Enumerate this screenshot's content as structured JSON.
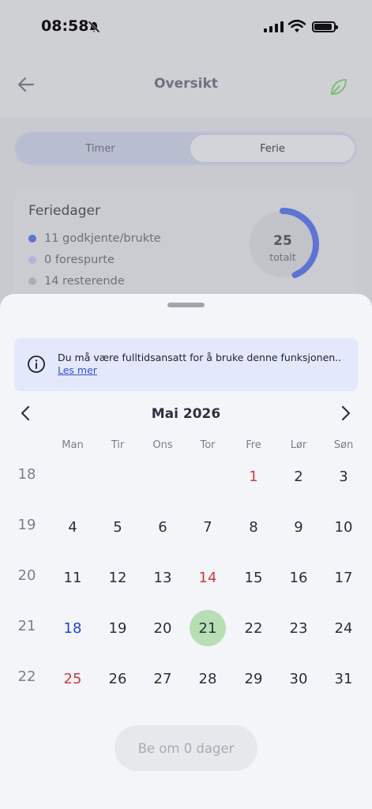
{
  "status_bar": {
    "time": "08:58"
  },
  "header": {
    "title": "Oversikt"
  },
  "segmented": {
    "timer_label": "Timer",
    "ferie_label": "Ferie",
    "selected": "Ferie"
  },
  "card": {
    "title": "Feriedager",
    "legend": [
      {
        "label": "11 godkjente/brukte",
        "color": "#5f73d3"
      },
      {
        "label": "0 forespurte",
        "color": "#aeb5d5"
      },
      {
        "label": "14 resterende",
        "color": "#adaeb3"
      }
    ],
    "ring_number": "25",
    "ring_label": "totalt",
    "approved_fraction": 0.44
  },
  "info": {
    "text": "Du må være fulltidsansatt for å bruke denne funksjonen..",
    "link": "Les mer"
  },
  "calendar": {
    "month_label": "Mai 2026",
    "weekdays": [
      "Man",
      "Tir",
      "Ons",
      "Tor",
      "Fre",
      "Lør",
      "Søn"
    ],
    "weeks": [
      {
        "week": "18",
        "days": [
          "",
          "",
          "",
          "",
          "1",
          "2",
          "3"
        ]
      },
      {
        "week": "19",
        "days": [
          "4",
          "5",
          "6",
          "7",
          "8",
          "9",
          "10"
        ]
      },
      {
        "week": "20",
        "days": [
          "11",
          "12",
          "13",
          "14",
          "15",
          "16",
          "17"
        ]
      },
      {
        "week": "21",
        "days": [
          "18",
          "19",
          "20",
          "21",
          "22",
          "23",
          "24"
        ]
      },
      {
        "week": "22",
        "days": [
          "25",
          "26",
          "27",
          "28",
          "29",
          "30",
          "31"
        ]
      }
    ],
    "holidays": [
      "1",
      "14",
      "25"
    ],
    "today": "18",
    "selected": "21",
    "colors": {
      "holiday": "#cc3b3b",
      "today": "#1f46c7",
      "selected_bg": "#b7dfb3"
    }
  },
  "request_button": {
    "label": "Be om 0 dager"
  }
}
